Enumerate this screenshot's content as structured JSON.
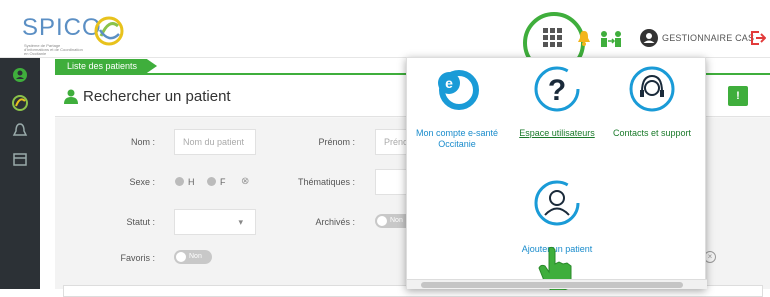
{
  "header": {
    "logo_text": "SPICO",
    "logo_sub": "Système de Partage d'Informations et de Coordination en Occitanie",
    "user_label": "GESTIONNAIRE CAS"
  },
  "breadcrumb": "Liste des patients",
  "panel": {
    "title": "Rechercher un patient",
    "info_button": "!"
  },
  "form": {
    "nom_label": "Nom :",
    "nom_placeholder": "Nom du patient",
    "prenom_label": "Prénom :",
    "prenom_placeholder": "Prénom",
    "sexe_label": "Sexe :",
    "sexe_h": "H",
    "sexe_f": "F",
    "thematiques_label": "Thématiques :",
    "statut_label": "Statut :",
    "archives_label": "Archivés :",
    "archives_toggle": "Non",
    "favoris_label": "Favoris :",
    "favoris_toggle": "Non"
  },
  "apps": [
    {
      "label": "Mon compte e-santé Occitanie",
      "icon": "e-sante-logo-icon"
    },
    {
      "label": "Espace utilisateurs",
      "icon": "help-question-icon"
    },
    {
      "label": "Contacts et support",
      "icon": "headset-support-icon"
    },
    {
      "label": "Ajouter un patient",
      "icon": "add-patient-icon"
    }
  ],
  "colors": {
    "accent": "#3fae3c",
    "app_blue": "#1a9bd7",
    "sidebar": "#2c3136",
    "logo_blue": "#5b8fc4"
  }
}
